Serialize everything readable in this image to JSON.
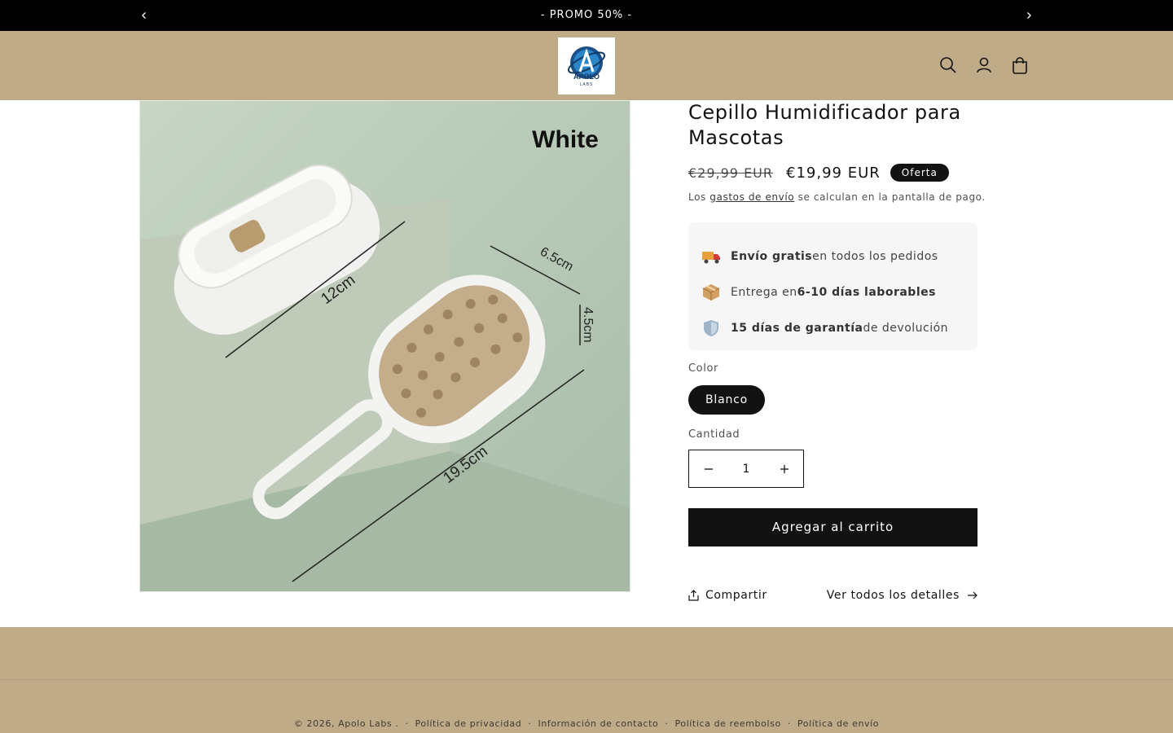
{
  "announcement": {
    "text": "- PROMO 50% -"
  },
  "header": {
    "logo_main": "APOLO",
    "logo_sub": "LABS"
  },
  "product": {
    "image_overlay": {
      "color_label": "White",
      "dim_length": "12cm",
      "dim_width": "6.5cm",
      "dim_height": "4.5cm",
      "dim_total": "19.5cm"
    },
    "title": "Cepillo Humidificador para Mascotas",
    "price_regular": "€29,99 EUR",
    "price_sale": "€19,99 EUR",
    "badge": "Oferta",
    "tax_prefix": "Los ",
    "tax_link": "gastos de envío",
    "tax_suffix": " se calculan en la pantalla de pago.",
    "benefits": [
      {
        "icon": "truck-icon",
        "bold": "Envío gratis",
        "pre": "",
        "post": " en todos los pedidos"
      },
      {
        "icon": "package-icon",
        "pre": "Entrega en ",
        "bold": "6-10 días laborables",
        "post": ""
      },
      {
        "icon": "shield-icon",
        "pre": "",
        "bold": "15 días de garantía",
        "post": " de devolución"
      }
    ],
    "color_label": "Color",
    "color_value": "Blanco",
    "quantity_label": "Cantidad",
    "quantity_value": "1",
    "add_to_cart": "Agregar al carrito",
    "share": "Compartir",
    "view_details": "Ver todos los detalles"
  },
  "footer": {
    "copyright": "© 2026, Apolo Labs .",
    "links": [
      "Política de privacidad",
      "Información de contacto",
      "Política de reembolso",
      "Política de envío"
    ]
  },
  "colors": {
    "header_bg": "#c0ab89",
    "announcement_bg": "#000000",
    "button_bg": "#121212"
  }
}
